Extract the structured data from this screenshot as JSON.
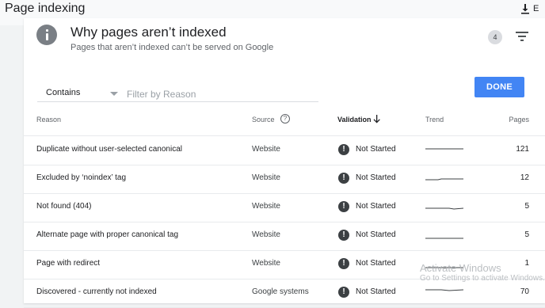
{
  "header": {
    "title": "Page indexing",
    "export_label": "E"
  },
  "card": {
    "title": "Why pages aren’t indexed",
    "subtitle": "Pages that aren’t indexed can’t be served on Google",
    "filter_count": "4"
  },
  "filter": {
    "mode": "Contains",
    "placeholder": "Filter by Reason",
    "done_label": "DONE"
  },
  "table": {
    "columns": {
      "reason": "Reason",
      "source": "Source",
      "validation": "Validation",
      "trend": "Trend",
      "pages": "Pages"
    },
    "rows": [
      {
        "reason": "Duplicate without user-selected canonical",
        "source": "Website",
        "validation": "Not Started",
        "pages": "121"
      },
      {
        "reason": "Excluded by ‘noindex’ tag",
        "source": "Website",
        "validation": "Not Started",
        "pages": "12"
      },
      {
        "reason": "Not found (404)",
        "source": "Website",
        "validation": "Not Started",
        "pages": "5"
      },
      {
        "reason": "Alternate page with proper canonical tag",
        "source": "Website",
        "validation": "Not Started",
        "pages": "5"
      },
      {
        "reason": "Page with redirect",
        "source": "Website",
        "validation": "Not Started",
        "pages": "1"
      },
      {
        "reason": "Discovered - currently not indexed",
        "source": "Google systems",
        "validation": "Not Started",
        "pages": "70"
      }
    ]
  },
  "watermark": {
    "title": "Activate Windows",
    "subtitle": "Go to Settings to activate Windows."
  },
  "colors": {
    "accent": "#4285f4",
    "status_icon": "#3c4043",
    "info_icon": "#7a7f85"
  }
}
